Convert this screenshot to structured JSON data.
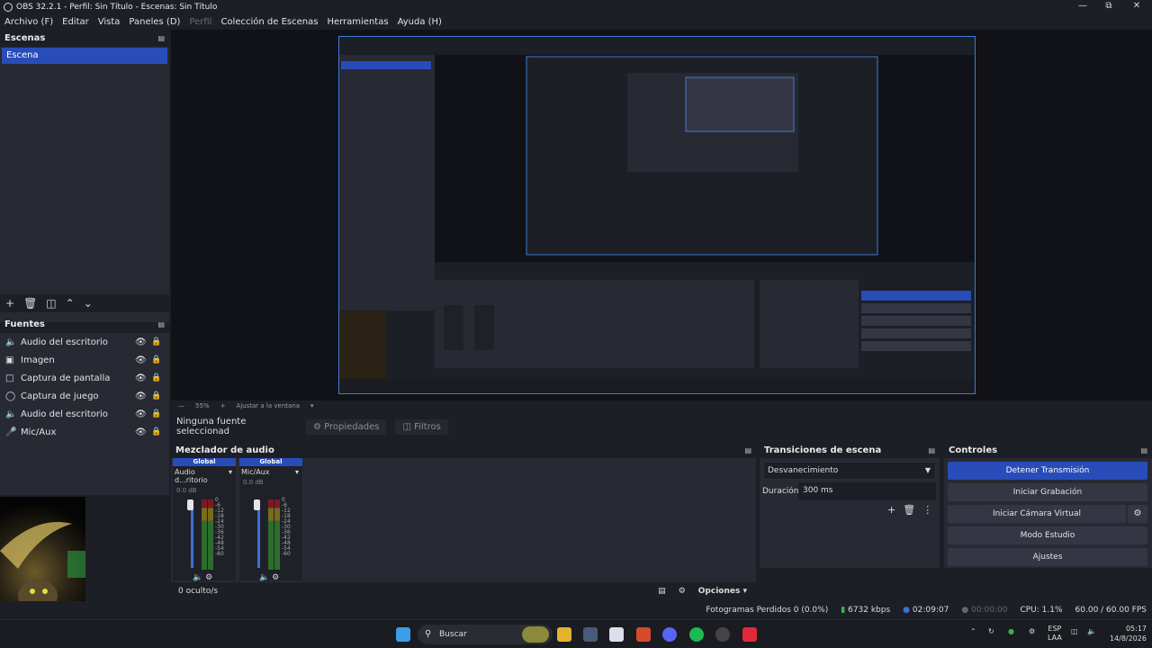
{
  "window": {
    "title": "OBS 32.2.1 - Perfil: Sin Título - Escenas: Sin Título",
    "min_icon": "minimize-icon",
    "max_icon": "maximize-icon",
    "close_icon": "close-icon"
  },
  "menu": {
    "items": [
      "Archivo (F)",
      "Editar",
      "Vista",
      "Paneles (D)",
      "Perfil",
      "Colección de Escenas",
      "Herramientas",
      "Ayuda (H)"
    ]
  },
  "scenes": {
    "title": "Escenas",
    "items": [
      "Escena"
    ]
  },
  "sources": {
    "title": "Fuentes",
    "items": [
      {
        "label": "Audio del escritorio",
        "icon": "speaker-icon"
      },
      {
        "label": "Imagen",
        "icon": "image-icon"
      },
      {
        "label": "Captura de pantalla",
        "icon": "monitor-icon"
      },
      {
        "label": "Captura de juego",
        "icon": "gamepad-icon"
      },
      {
        "label": "Audio del escritorio",
        "icon": "speaker-icon"
      },
      {
        "label": "Mic/Aux",
        "icon": "microphone-icon"
      }
    ]
  },
  "preview": {
    "zoom": "55%",
    "fit_label": "Ajustar a la ventana"
  },
  "context": {
    "no_selection": "Ninguna fuente seleccionad",
    "properties": "Propiedades",
    "filters": "Filtros"
  },
  "mixer": {
    "title": "Mezclador de audio",
    "channels": [
      {
        "header": "Global",
        "name": "Audio d...ritorio",
        "db": "0.0 dB"
      },
      {
        "header": "Global",
        "name": "Mic/Aux",
        "db": "0.0 dB"
      }
    ],
    "scale": [
      "0",
      "-6",
      "-12",
      "-18",
      "-24",
      "-30",
      "-36",
      "-42",
      "-48",
      "-54",
      "-60"
    ],
    "hidden": "0 oculto/s",
    "options": "Opciones"
  },
  "transitions": {
    "title": "Transiciones de escena",
    "selected": "Desvanecimiento",
    "duration_label": "Duración",
    "duration_value": "300 ms"
  },
  "controls": {
    "title": "Controles",
    "stop_stream": "Detener Transmisión",
    "start_record": "Iniciar Grabación",
    "start_vcam": "Iniciar Cámara Virtual",
    "studio_mode": "Modo Estudio",
    "settings": "Ajustes"
  },
  "status": {
    "dropped_frames": "Fotogramas Perdidos 0 (0.0%)",
    "bitrate": "6732 kbps",
    "stream_time": "02:09:07",
    "record_time": "00:00:00",
    "cpu": "CPU: 1.1%",
    "fps": "60.00 / 60.00 FPS"
  },
  "taskbar": {
    "search": "Buscar",
    "lang_top": "ESP",
    "lang_bottom": "LAA",
    "time": "05:17",
    "date": "14/8/2026"
  },
  "colors": {
    "accent": "#284cb8",
    "panel": "#272a33",
    "background": "#1d1f26"
  }
}
